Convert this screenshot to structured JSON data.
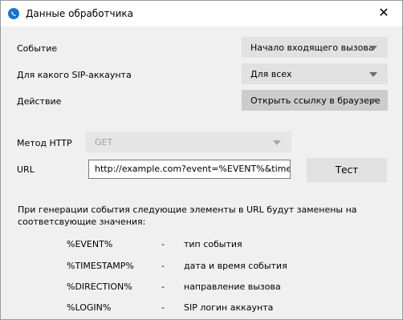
{
  "window": {
    "title": "Данные обработчика",
    "close_glyph": "✕"
  },
  "form": {
    "event_label": "Событие",
    "event_value": "Начало входящего вызова",
    "account_label": "Для какого SIP-аккаунта",
    "account_value": "Для всех",
    "action_label": "Действие",
    "action_value": "Открыть ссылку в браузере",
    "method_label": "Метод HTTP",
    "method_value": "GET",
    "url_label": "URL",
    "url_value": "http://example.com?event=%EVENT%&timestamp=%TIMESTAMP%",
    "test_label": "Тест"
  },
  "info_text": "При генерации события следующие элементы в URL будут заменены на соответсвующие значения:",
  "variables": [
    {
      "name": "%EVENT%",
      "dash": "-",
      "desc": "тип события"
    },
    {
      "name": "%TIMESTAMP%",
      "dash": "-",
      "desc": "дата и время события"
    },
    {
      "name": "%DIRECTION%",
      "dash": "-",
      "desc": "направление вызова"
    },
    {
      "name": "%LOGIN%",
      "dash": "-",
      "desc": "SIP логин аккаунта"
    }
  ],
  "colors": {
    "accent": "#1a73c8",
    "background": "#f0f0f0"
  },
  "icons": {
    "app": "phone-handler-icon",
    "close": "close-icon",
    "dropdown": "chevron-down-icon"
  }
}
